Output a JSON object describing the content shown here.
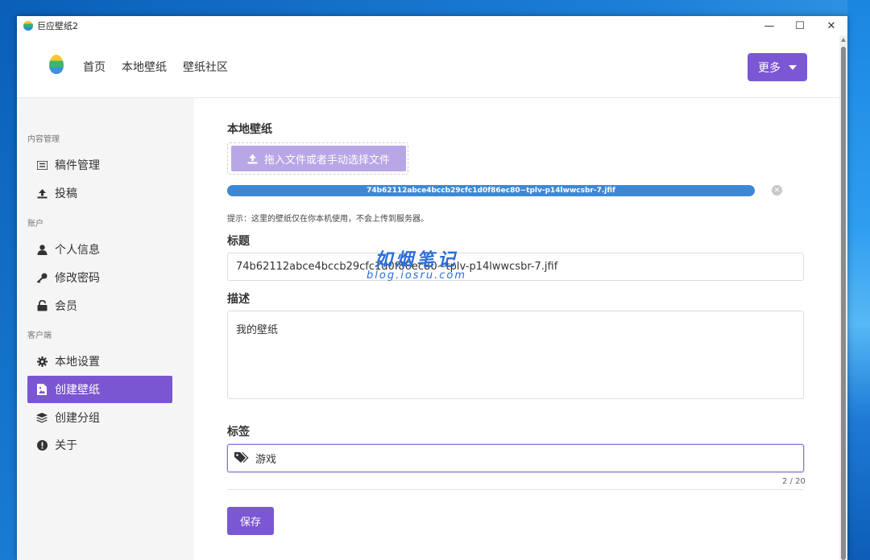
{
  "window": {
    "title": "巨应壁纸2"
  },
  "header": {
    "nav": [
      "首页",
      "本地壁纸",
      "壁纸社区"
    ],
    "more_label": "更多"
  },
  "sidebar": {
    "groups": [
      {
        "label": "内容管理",
        "items": [
          {
            "label": "稿件管理",
            "icon": "list-icon"
          },
          {
            "label": "投稿",
            "icon": "upload-icon"
          }
        ]
      },
      {
        "label": "账户",
        "items": [
          {
            "label": "个人信息",
            "icon": "user-icon"
          },
          {
            "label": "修改密码",
            "icon": "key-icon"
          },
          {
            "label": "会员",
            "icon": "unlock-icon"
          }
        ]
      },
      {
        "label": "客户端",
        "items": [
          {
            "label": "本地设置",
            "icon": "gear-icon"
          },
          {
            "label": "创建壁纸",
            "icon": "image-file-icon",
            "active": true
          },
          {
            "label": "创建分组",
            "icon": "layers-icon"
          },
          {
            "label": "关于",
            "icon": "info-icon"
          }
        ]
      }
    ]
  },
  "form": {
    "local_wallpaper_label": "本地壁纸",
    "upload_label": "拖入文件或者手动选择文件",
    "file_name": "74b62112abce4bccb29cfc1d0f86ec80~tplv-p14lwwcsbr-7.jfif",
    "upload_progress": 1.0,
    "hint": "提示：这里的壁纸仅在你本机使用，不会上传到服务器。",
    "title_label": "标题",
    "title_value": "74b62112abce4bccb29cfc1d0f86ec80~tplv-p14lwwcsbr-7.jfif",
    "desc_label": "描述",
    "desc_value": "我的壁纸",
    "tags_label": "标签",
    "tags_value": "游戏",
    "counter": "2 / 20",
    "save_label": "保存"
  },
  "watermark": {
    "title": "如烟笔记",
    "subtitle": "blog.iosru.com"
  },
  "colors": {
    "accent": "#7c57d4",
    "progress": "#3d88d6"
  }
}
